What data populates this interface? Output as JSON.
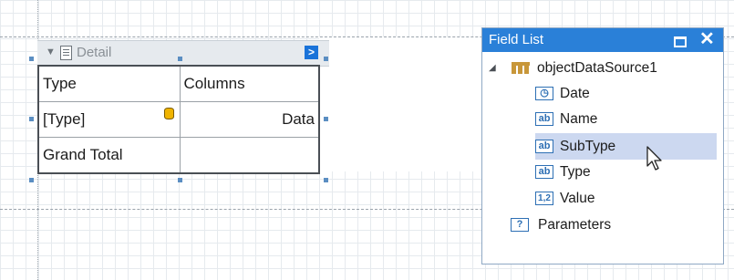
{
  "band": {
    "label": "Detail"
  },
  "smart_tag": {
    "glyph": ">"
  },
  "pivot": {
    "rows": [
      {
        "label": "Type",
        "value": "Columns"
      },
      {
        "label": "[Type]",
        "value": "Data"
      },
      {
        "label": "Grand Total",
        "value": ""
      }
    ]
  },
  "field_list": {
    "title": "Field List",
    "maximize_glyph": "",
    "close_glyph": "✕",
    "root": {
      "label": "objectDataSource1",
      "expanded_glyph": "◢"
    },
    "fields": [
      {
        "label": "Date",
        "icon": "clock-icon",
        "glyph": "◷"
      },
      {
        "label": "Name",
        "icon": "string-field-icon",
        "glyph": "ab"
      },
      {
        "label": "SubType",
        "icon": "string-field-icon",
        "glyph": "ab",
        "selected": true
      },
      {
        "label": "Type",
        "icon": "string-field-icon",
        "glyph": "ab"
      },
      {
        "label": "Value",
        "icon": "number-field-icon",
        "glyph": "1,2"
      }
    ],
    "parameters": {
      "label": "Parameters",
      "glyph": "?"
    }
  },
  "colors": {
    "accent": "#2a80d8",
    "selection": "#ccd8f0",
    "grid": "#e6eaee"
  }
}
